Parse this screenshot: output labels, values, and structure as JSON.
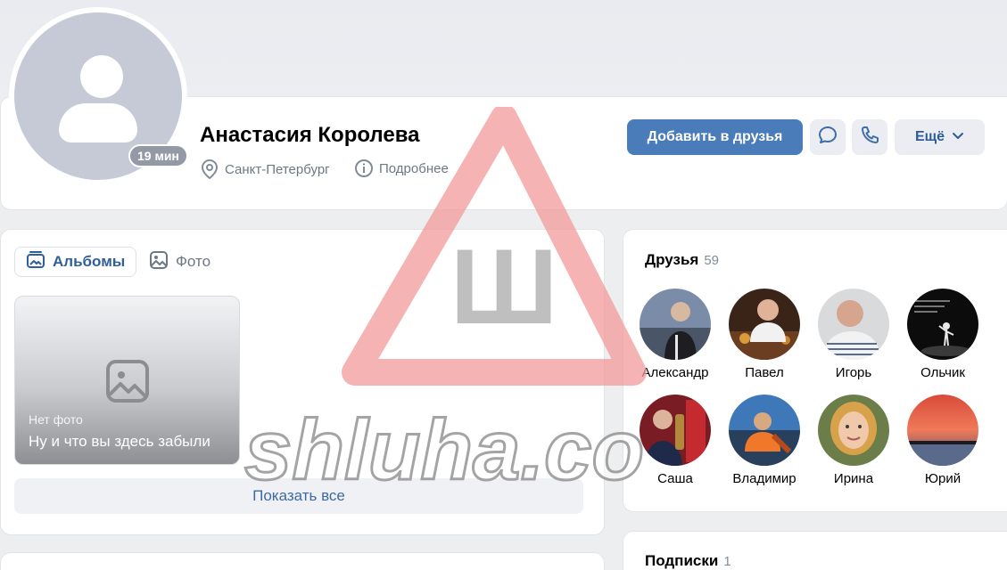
{
  "profile": {
    "name": "Анастасия Королева",
    "last_seen": "19 мин",
    "city": "Санкт-Петербург",
    "details_label": "Подробнее"
  },
  "actions": {
    "add_friend_label": "Добавить в друзья",
    "more_label": "Ещё"
  },
  "photos": {
    "tabs": [
      {
        "label": "Альбомы",
        "active": true
      },
      {
        "label": "Фото",
        "active": false
      }
    ],
    "album": {
      "subtitle": "Нет фото",
      "title": "Ну и что вы здесь забыли"
    },
    "show_all_label": "Показать все"
  },
  "friends": {
    "title": "Друзья",
    "count": "59",
    "items": [
      {
        "name": "Александр"
      },
      {
        "name": "Павел"
      },
      {
        "name": "Игорь"
      },
      {
        "name": "Ольчик"
      },
      {
        "name": "Саша"
      },
      {
        "name": "Владимир"
      },
      {
        "name": "Ирина"
      },
      {
        "name": "Юрий"
      }
    ]
  },
  "subscriptions": {
    "title": "Подписки",
    "count": "1"
  },
  "watermark": {
    "letter": "Ш",
    "text": "shluha.co"
  },
  "colors": {
    "accent": "#4a7cba",
    "link": "#2f5f99",
    "secondary_text": "#6d7885",
    "page_bg": "#edeef0",
    "watermark_red": "#f5a3a3"
  }
}
